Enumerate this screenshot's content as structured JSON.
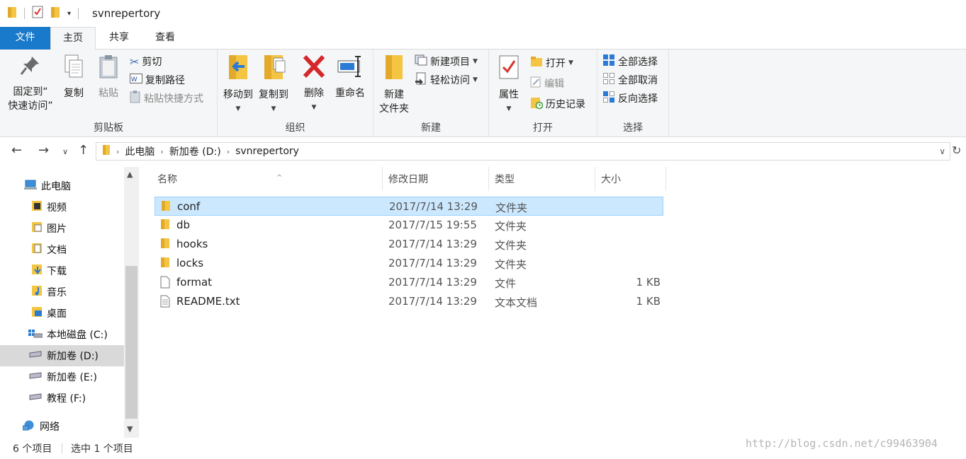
{
  "window": {
    "title": "svnrepertory"
  },
  "ribbon_tabs": [
    {
      "label": "文件",
      "active": false
    },
    {
      "label": "主页",
      "active": true
    },
    {
      "label": "共享",
      "active": false
    },
    {
      "label": "查看",
      "active": false
    }
  ],
  "ribbon": {
    "clipboard": {
      "label": "剪贴板",
      "pin_line1": "固定到“",
      "pin_line2": "快速访问”",
      "copy": "复制",
      "paste": "粘贴",
      "cut": "剪切",
      "copy_path": "复制路径",
      "paste_shortcut": "粘贴快捷方式"
    },
    "organize": {
      "label": "组织",
      "move_to": "移动到",
      "copy_to": "复制到",
      "delete": "删除",
      "rename": "重命名"
    },
    "new": {
      "label": "新建",
      "new_folder_line1": "新建",
      "new_folder_line2": "文件夹",
      "new_item": "新建项目",
      "easy_access": "轻松访问"
    },
    "open": {
      "label": "打开",
      "properties": "属性",
      "open": "打开",
      "edit": "编辑",
      "history": "历史记录"
    },
    "select": {
      "label": "选择",
      "select_all": "全部选择",
      "select_none": "全部取消",
      "invert": "反向选择"
    }
  },
  "address": {
    "crumbs": [
      "此电脑",
      "新加卷 (D:)",
      "svnrepertory"
    ]
  },
  "nav": {
    "items": [
      {
        "label": "此电脑",
        "icon": "computer-icon"
      },
      {
        "label": "视频",
        "icon": "video-folder-icon"
      },
      {
        "label": "图片",
        "icon": "pictures-folder-icon"
      },
      {
        "label": "文档",
        "icon": "documents-folder-icon"
      },
      {
        "label": "下载",
        "icon": "downloads-folder-icon"
      },
      {
        "label": "音乐",
        "icon": "music-folder-icon"
      },
      {
        "label": "桌面",
        "icon": "desktop-folder-icon"
      },
      {
        "label": "本地磁盘 (C:)",
        "icon": "system-drive-icon"
      },
      {
        "label": "新加卷 (D:)",
        "icon": "drive-icon",
        "selected": true
      },
      {
        "label": "新加卷 (E:)",
        "icon": "drive-icon"
      },
      {
        "label": "教程 (F:)",
        "icon": "drive-icon"
      },
      {
        "label": "网络",
        "icon": "network-icon"
      }
    ]
  },
  "columns": {
    "name": "名称",
    "date": "修改日期",
    "type": "类型",
    "size": "大小"
  },
  "files": [
    {
      "name": "conf",
      "date": "2017/7/14 13:29",
      "type": "文件夹",
      "size": "",
      "icon": "folder-icon",
      "selected": true
    },
    {
      "name": "db",
      "date": "2017/7/15 19:55",
      "type": "文件夹",
      "size": "",
      "icon": "folder-icon"
    },
    {
      "name": "hooks",
      "date": "2017/7/14 13:29",
      "type": "文件夹",
      "size": "",
      "icon": "folder-icon"
    },
    {
      "name": "locks",
      "date": "2017/7/14 13:29",
      "type": "文件夹",
      "size": "",
      "icon": "folder-icon"
    },
    {
      "name": "format",
      "date": "2017/7/14 13:29",
      "type": "文件",
      "size": "1 KB",
      "icon": "file-icon"
    },
    {
      "name": "README.txt",
      "date": "2017/7/14 13:29",
      "type": "文本文档",
      "size": "1 KB",
      "icon": "text-file-icon"
    }
  ],
  "status": {
    "count": "6 个项目",
    "selected": "选中 1 个项目"
  },
  "watermark": "http://blog.csdn.net/c99463904",
  "colors": {
    "accent": "#1979ca",
    "selection": "#cce8ff",
    "folder": "#f4c542"
  }
}
